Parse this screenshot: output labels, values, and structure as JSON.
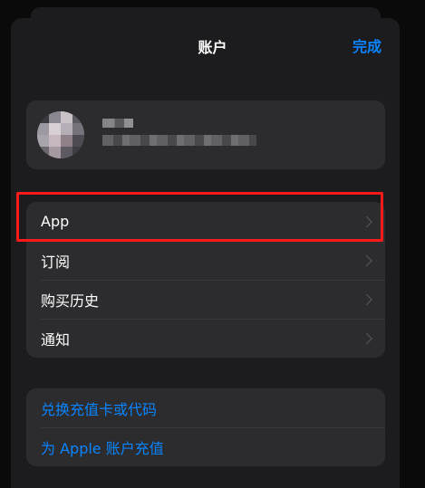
{
  "nav": {
    "title": "账户",
    "done_label": "完成"
  },
  "menu": {
    "items": [
      {
        "label": "App"
      },
      {
        "label": "订阅"
      },
      {
        "label": "购买历史"
      },
      {
        "label": "通知"
      }
    ]
  },
  "links": {
    "redeem": "兑换充值卡或代码",
    "add_funds": "为 Apple 账户充值"
  },
  "colors": {
    "accent": "#0a84ff",
    "highlight": "#ff1a1a"
  }
}
